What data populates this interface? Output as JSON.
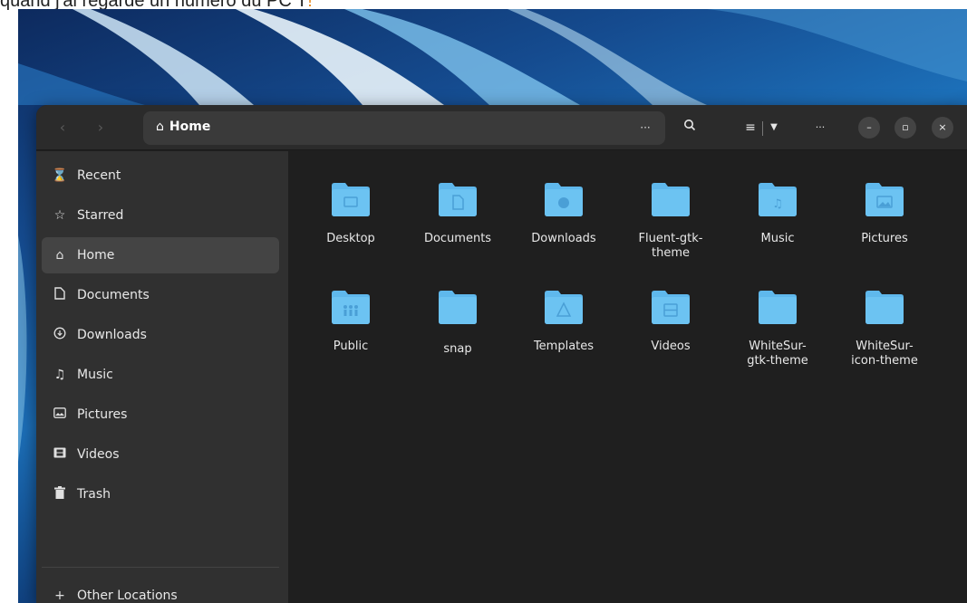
{
  "caption": {
    "text": "quand j'ai regardé un numéro du PC T",
    "accent": "!",
    "accent_color": "#e8891c"
  },
  "window": {
    "background": "#1f1f1f",
    "headerbar_color": "#2b2b2b",
    "sidebar_color": "#303030"
  },
  "headerbar": {
    "back_icon": "chevron-left-icon",
    "forward_icon": "chevron-right-icon",
    "path": {
      "icon": "home-icon",
      "label": "Home",
      "more_icon": "ellipsis-icon"
    },
    "search_icon": "search-icon",
    "view_icon": "list-view-icon",
    "view_dropdown_icon": "chevron-down-icon",
    "menu_icon": "ellipsis-icon",
    "minimize_icon": "minimize-icon",
    "maximize_icon": "maximize-icon",
    "close_icon": "close-icon"
  },
  "sidebar": {
    "items": [
      {
        "label": "Recent",
        "icon": "clock-icon"
      },
      {
        "label": "Starred",
        "icon": "star-icon"
      },
      {
        "label": "Home",
        "icon": "home-icon",
        "active": true
      },
      {
        "label": "Documents",
        "icon": "document-icon"
      },
      {
        "label": "Downloads",
        "icon": "download-icon"
      },
      {
        "label": "Music",
        "icon": "music-icon"
      },
      {
        "label": "Pictures",
        "icon": "picture-icon"
      },
      {
        "label": "Videos",
        "icon": "video-icon"
      },
      {
        "label": "Trash",
        "icon": "trash-icon"
      }
    ],
    "other_locations": {
      "label": "Other Locations",
      "icon": "plus-icon"
    }
  },
  "files": [
    {
      "name": "Desktop",
      "icon": "folder-desktop-icon"
    },
    {
      "name": "Documents",
      "icon": "folder-documents-icon"
    },
    {
      "name": "Downloads",
      "icon": "folder-downloads-icon"
    },
    {
      "name": "Fluent-gtk-\ntheme",
      "icon": "folder-icon"
    },
    {
      "name": "Music",
      "icon": "folder-music-icon"
    },
    {
      "name": "Pictures",
      "icon": "folder-pictures-icon"
    },
    {
      "name": "Public",
      "icon": "folder-public-icon"
    },
    {
      "name": "snap",
      "icon": "folder-icon"
    },
    {
      "name": "Templates",
      "icon": "folder-templates-icon"
    },
    {
      "name": "Videos",
      "icon": "folder-videos-icon"
    },
    {
      "name": "WhiteSur-\ngtk-theme",
      "icon": "folder-icon"
    },
    {
      "name": "WhiteSur-\nicon-theme",
      "icon": "folder-icon"
    }
  ],
  "folder_color": "#5fb8ec"
}
